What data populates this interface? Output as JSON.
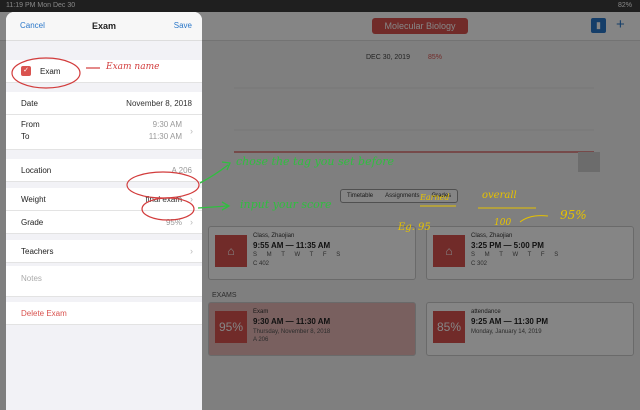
{
  "status": {
    "time_date": "11:19 PM  Mon Dec 30",
    "battery": "82%"
  },
  "background": {
    "subject": "Molecular Biology",
    "date": "DEC 30, 2019",
    "percent": "85%",
    "segments": [
      "Timetable",
      "Assignments",
      "Grades"
    ],
    "classes": [
      {
        "title": "Class, Zhaojian",
        "time": "9:55 AM — 11:35 AM",
        "days": "S M T W T F S",
        "room": "C 402"
      },
      {
        "title": "Class, Zhaojian",
        "time": "3:25 PM — 5:00 PM",
        "days": "S M T W T F S",
        "room": "C 302"
      }
    ],
    "exams_label": "EXAMS",
    "exams": [
      {
        "score": "95%",
        "title": "Exam",
        "time": "9:30 AM — 11:30 AM",
        "date": "Thursday, November 8, 2018",
        "room": "A 206"
      },
      {
        "score": "85%",
        "title": "attendance",
        "time": "9:25 AM — 11:30 PM",
        "date": "Monday, January 14, 2019",
        "room": ""
      }
    ]
  },
  "modal": {
    "cancel": "Cancel",
    "title": "Exam",
    "save": "Save",
    "exam_name": "Exam",
    "date_label": "Date",
    "date_value": "November 8, 2018",
    "from_label": "From",
    "from_value": "9:30 AM",
    "to_label": "To",
    "to_value": "11:30 AM",
    "location_label": "Location",
    "location_value": "A 206",
    "weight_label": "Weight",
    "weight_value": "final exam",
    "grade_label": "Grade",
    "grade_value": "95%",
    "teachers_label": "Teachers",
    "notes_placeholder": "Notes",
    "delete": "Delete Exam"
  },
  "annotations": {
    "exam_name": "Exam name",
    "tag": "chose the tag you set before",
    "score": "input your score",
    "earned": "Earned",
    "overall": "overall",
    "eg": "Eg. 95",
    "hundred": "100",
    "result": "95%"
  },
  "colors": {
    "accent": "#d9534f",
    "link": "#2a77c9",
    "ink_green": "#2fbf3f",
    "ink_red": "#d23c3c",
    "ink_yellow": "#e6c200"
  }
}
